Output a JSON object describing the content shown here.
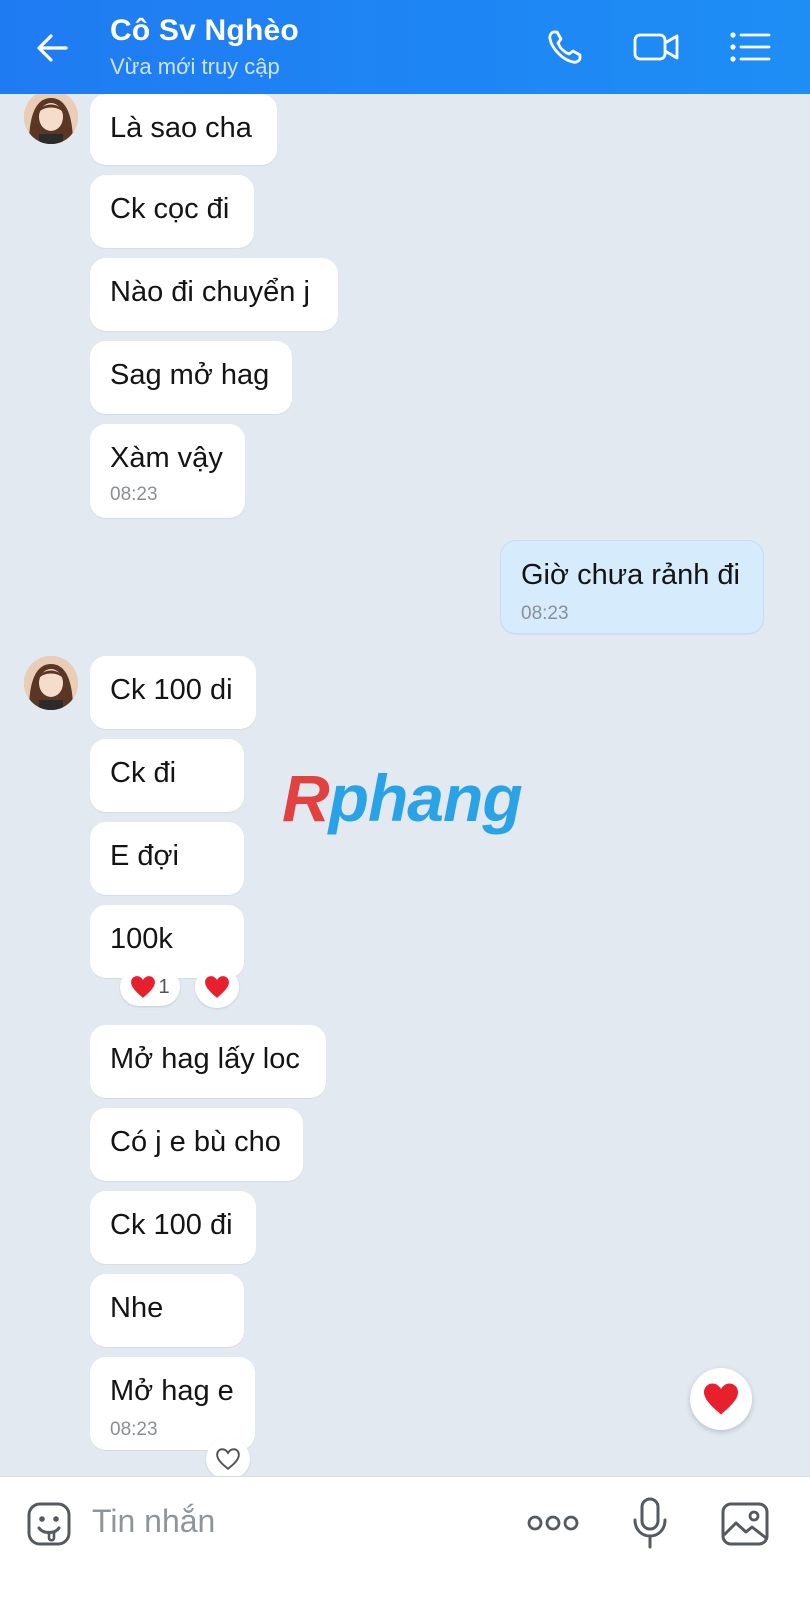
{
  "header": {
    "title": "Cô Sv Nghèo",
    "status": "Vừa mới truy cập"
  },
  "messages": [
    {
      "text": "Là sao cha",
      "side": "left"
    },
    {
      "text": "Ck cọc đi",
      "side": "left"
    },
    {
      "text": "Nào đi chuyển j",
      "side": "left"
    },
    {
      "text": "Sag mở hag",
      "side": "left"
    },
    {
      "text": "Xàm vậy",
      "time": "08:23",
      "side": "left"
    },
    {
      "text": "Giờ chưa rảnh đi",
      "time": "08:23",
      "side": "right"
    },
    {
      "text": "Ck 100 di",
      "side": "left"
    },
    {
      "text": "Ck đi",
      "side": "left"
    },
    {
      "text": "E đợi",
      "side": "left"
    },
    {
      "text": "100k",
      "side": "left"
    },
    {
      "text": "Mở hag lấy loc",
      "side": "left"
    },
    {
      "text": "Có j e bù cho",
      "side": "left"
    },
    {
      "text": "Ck 100 đi",
      "side": "left"
    },
    {
      "text": "Nhe",
      "side": "left"
    },
    {
      "text": "Mở hag e",
      "time": "08:23",
      "side": "left"
    }
  ],
  "reactions": {
    "heart_count": "1"
  },
  "watermark": {
    "first_letter": "R",
    "rest": "phang"
  },
  "input": {
    "placeholder": "Tin nhắn"
  },
  "colors": {
    "header_bg": "#1e86f4",
    "chat_bg": "#e2e9f1",
    "my_bubble": "#d6ecfc",
    "heart": "#e8202e"
  }
}
